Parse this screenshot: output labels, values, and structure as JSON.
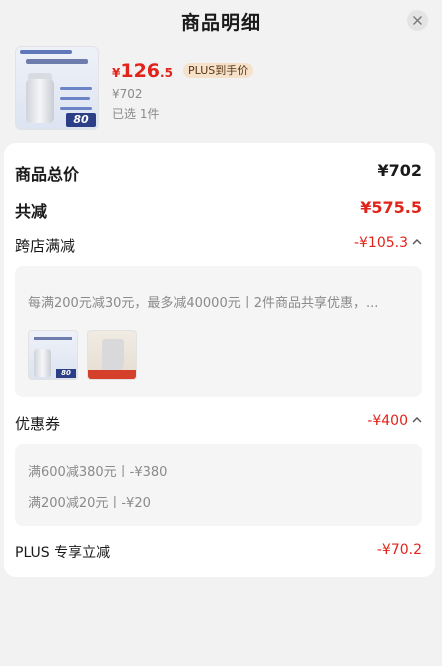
{
  "header": {
    "title": "商品明细"
  },
  "product": {
    "price_symbol": "¥",
    "price_int": "126",
    "price_dec": ".5",
    "plus_badge": "PLUS到手价",
    "original_price": "¥702",
    "picked": "已选 1件",
    "thumb_tag": "80"
  },
  "summary": {
    "total_label": "商品总价",
    "total_value": "¥702",
    "discount_label": "共减",
    "discount_value": "¥575.5"
  },
  "cross_store": {
    "label": "跨店满减",
    "value": "-¥105.3",
    "description": "每满200元减30元，最多减40000元丨2件商品共享优惠，...",
    "items": [
      {
        "name": "supplement-product",
        "tag": "80"
      },
      {
        "name": "sock-product"
      }
    ]
  },
  "coupon": {
    "label": "优惠券",
    "value": "-¥400",
    "lines": [
      "满600减380元丨-¥380",
      "满200减20元丨-¥20"
    ]
  },
  "plus": {
    "label": "PLUS 专享立减",
    "value": "-¥70.2"
  },
  "colors": {
    "accent_red": "#e2231a",
    "plus_badge_bg": "#f6e2cb"
  }
}
